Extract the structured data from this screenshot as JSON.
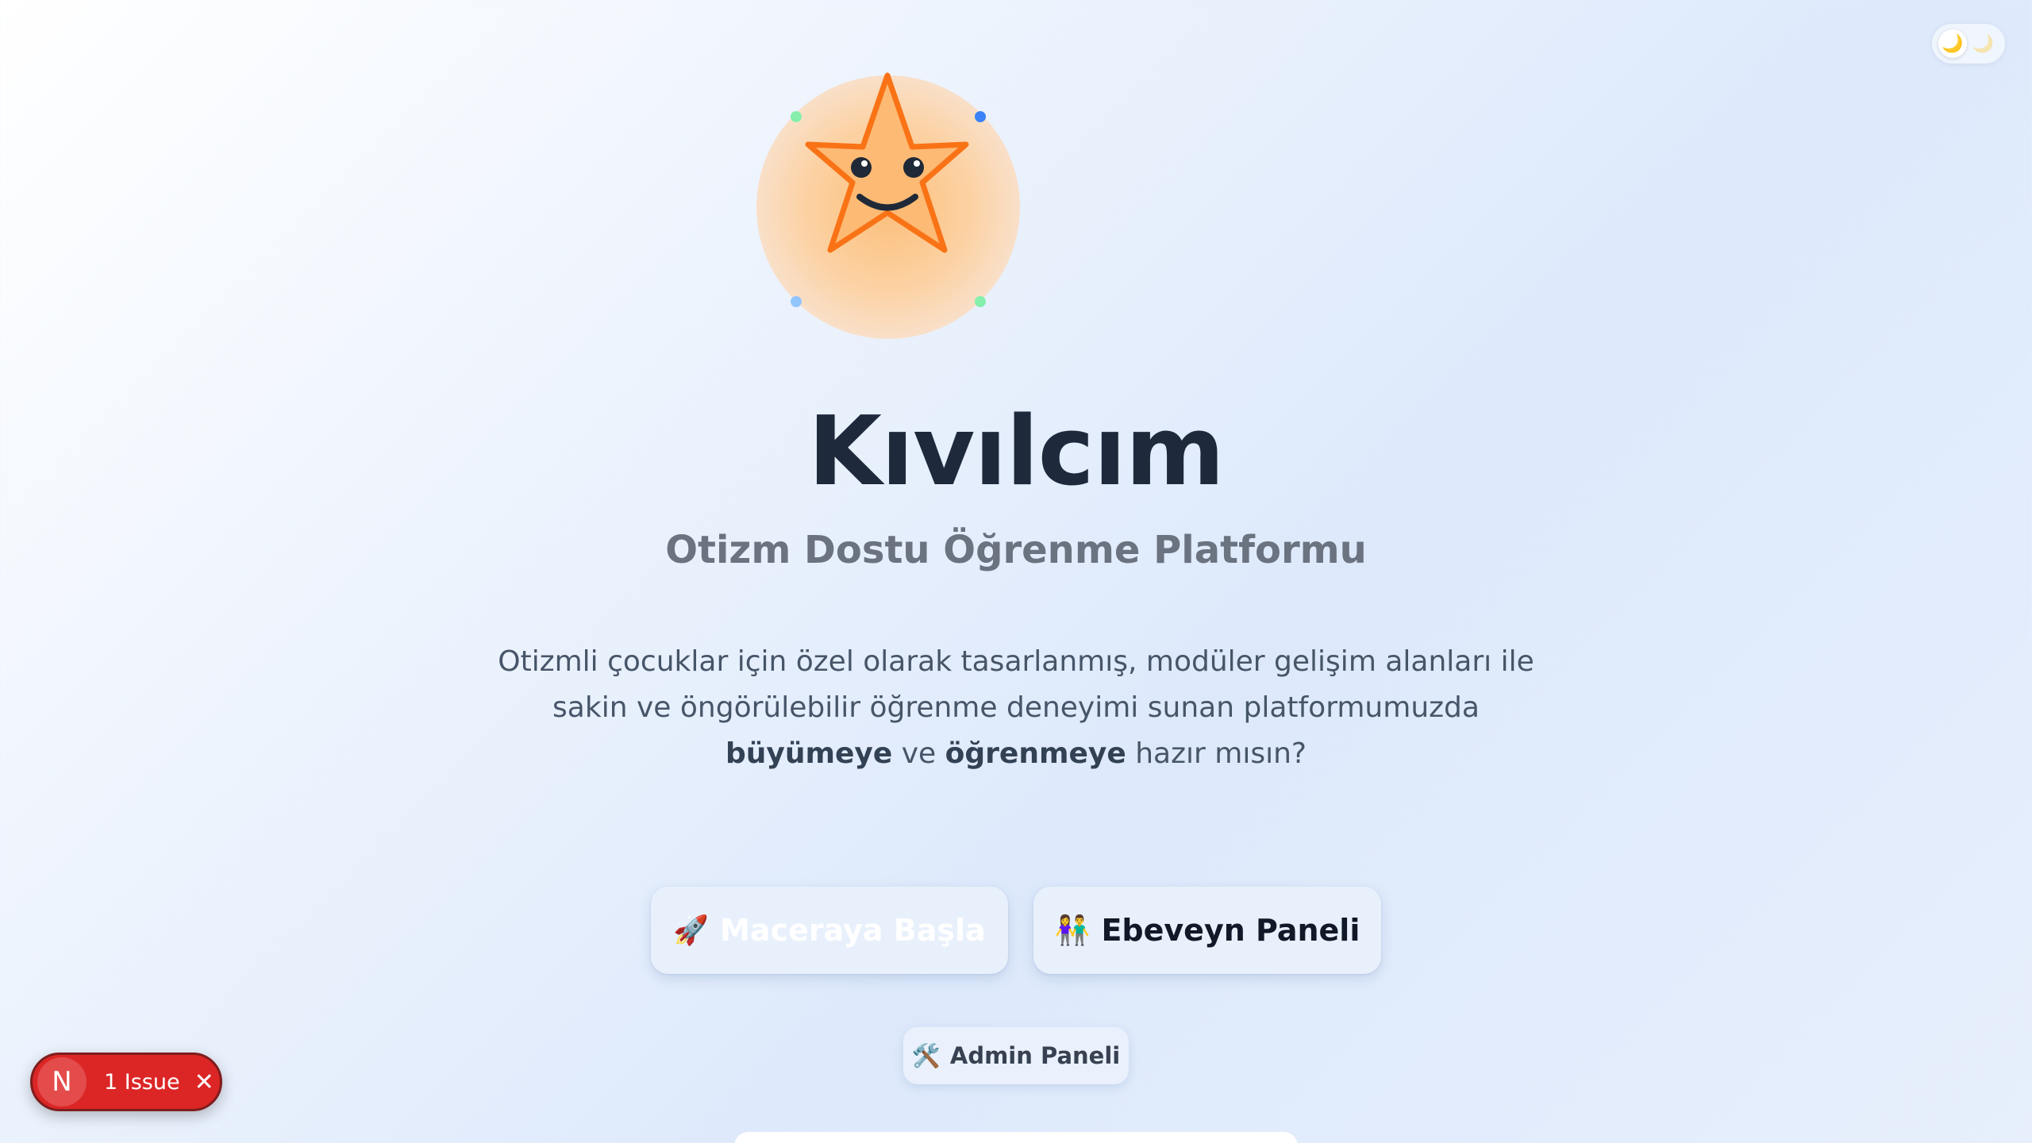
{
  "theme_toggle": {
    "sun_icon": "sun-icon",
    "moon_icon": "moon-icon"
  },
  "mascot": {
    "icon": "smiling-star-icon",
    "colors": {
      "star": "#fb923c",
      "outline": "#f97316",
      "glow": "#fcd2a4"
    }
  },
  "hero": {
    "title": "Kıvılcım",
    "subtitle": "Otizm Dostu Öğrenme Platformu",
    "description_part1": "Otizmli çocuklar için özel olarak tasarlanmış, modüler gelişim alanları ile sakin ve öngörülebilir öğrenme deneyimi sunan platformumuzda ",
    "description_bold1": "büyümeye",
    "description_part2": " ve ",
    "description_bold2": "öğrenmeye",
    "description_part3": " hazır mısın?"
  },
  "actions": {
    "start_label": "Maceraya Başla",
    "start_emoji": "🚀",
    "parent_label": "Ebeveyn Paneli",
    "parent_emoji": "👫",
    "admin_label": "Admin Paneli",
    "admin_emoji": "🛠️"
  },
  "dev_overlay": {
    "logo_letter": "N",
    "issue_label": "1 Issue",
    "close_glyph": "✕",
    "color": "#dc2626"
  }
}
